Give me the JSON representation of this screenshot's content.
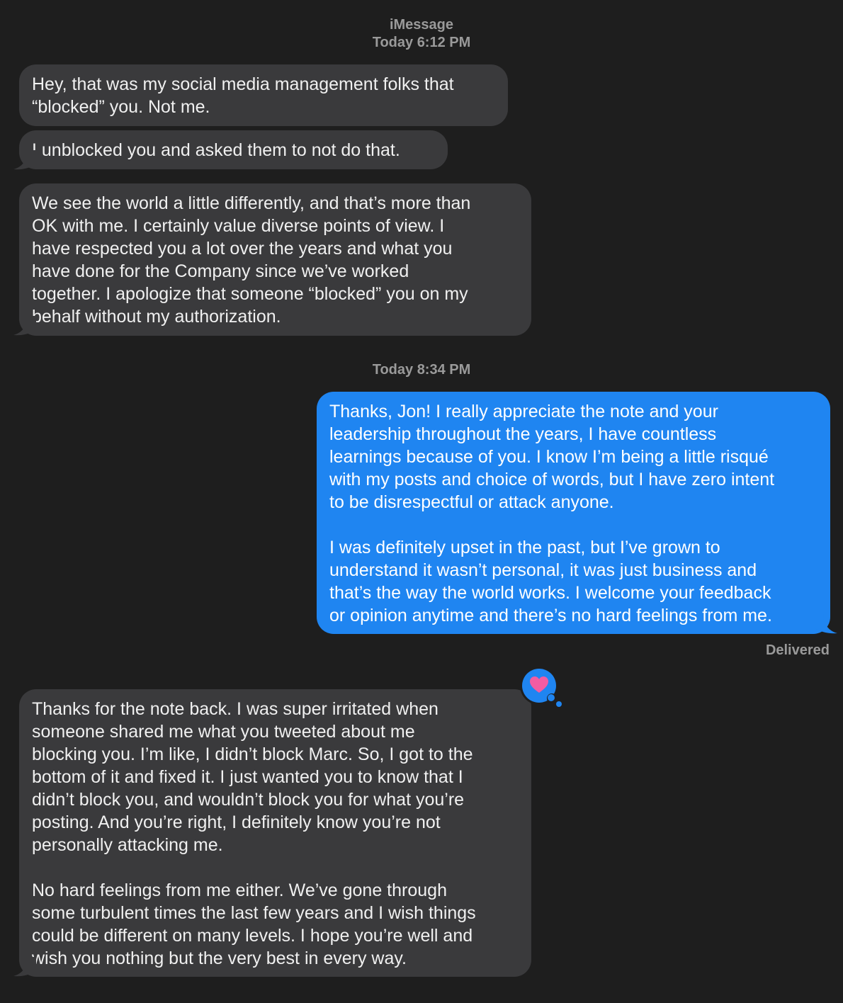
{
  "header": {
    "service": "iMessage",
    "time1": "Today 6:12 PM",
    "time2": "Today 8:34 PM"
  },
  "messages": [
    {
      "text": "Hey, that was my social media management folks that\n“blocked” you. Not me."
    },
    {
      "text": "I unblocked you and asked them to not do that."
    },
    {
      "text": "We see the world a little differently, and that’s more than\nOK with me. I certainly value diverse points of view. I\nhave respected you a lot over the years and what you\nhave done for the Company since we’ve worked\ntogether. I apologize that someone “blocked” you on my\nbehalf without my authorization."
    },
    {
      "text": "Thanks, Jon! I really appreciate the note and your\nleadership throughout the years, I have countless\nlearnings because of you. I know I’m being a little risqué\nwith my posts and choice of words, but I have zero intent\nto be disrespectful or attack anyone.\n\nI was definitely upset in the past, but I’ve grown to\nunderstand it wasn’t personal, it was just business and\nthat’s the way the world works. I welcome your feedback\nor opinion anytime and there’s no hard feelings from me."
    },
    {
      "text": "Thanks for the note back. I was super irritated when\nsomeone shared me what you tweeted about me\nblocking you. I’m like, I didn’t block Marc. So, I got to the\nbottom of it and fixed it. I just wanted you to know that I\ndidn’t block you, and wouldn’t block you for what you’re\nposting. And you’re right, I definitely know you’re not\npersonally attacking me.\n\nNo hard feelings from me either. We’ve gone through\nsome turbulent times the last few years and I wish things\ncould be different on many levels. I hope you’re well and\nwish you nothing but the very best in every way."
    }
  ],
  "status": {
    "delivered": "Delivered"
  },
  "tapback": {
    "icon": "heart-icon"
  },
  "colors": {
    "background": "#1e1e1e",
    "incoming_bubble": "#3a3a3c",
    "outgoing_bubble": "#1f85f1",
    "heart": "#f25ca2"
  }
}
